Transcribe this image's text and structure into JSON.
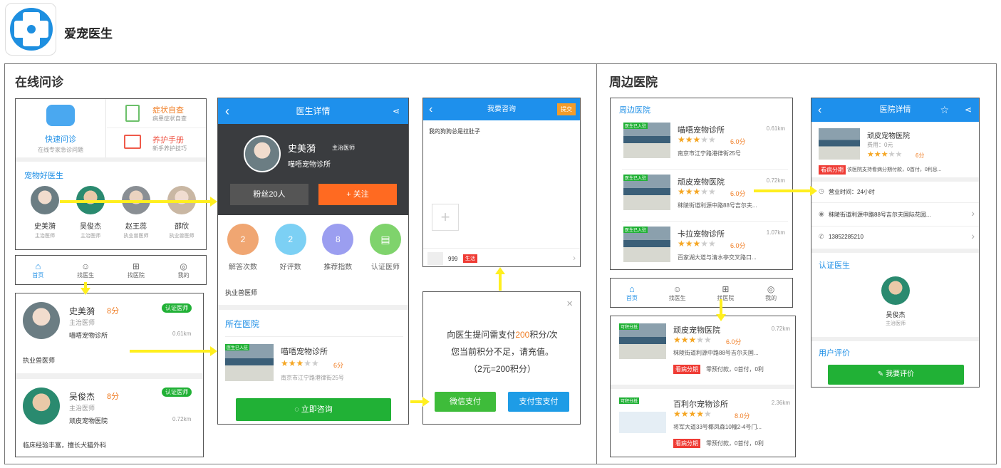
{
  "app": {
    "name": "爱宠医生"
  },
  "sections": {
    "consult": "在线问诊",
    "nearby": "周边医院"
  },
  "home": {
    "quick_title": "快速问诊",
    "quick_sub": "在线专家急诊问题",
    "symptom_title": "症状自查",
    "symptom_sub": "病患症状自查",
    "care_title": "养护手册",
    "care_sub": "新手养护技巧",
    "good_doctors": "宠物好医生",
    "doctors": [
      {
        "name": "史美漪",
        "title": "主治医师"
      },
      {
        "name": "吴俊杰",
        "title": "主治医师"
      },
      {
        "name": "赵王蕊",
        "title": "执业兽医师"
      },
      {
        "name": "邵欣",
        "title": "执业兽医师"
      }
    ]
  },
  "tabs": [
    "首页",
    "找医生",
    "找医院",
    "我的"
  ],
  "doctor_list": [
    {
      "name": "史美漪",
      "score": "8分",
      "badge": "认证医师",
      "title": "主治医师",
      "clinic": "喵唔宠物诊所",
      "distance": "0.61km",
      "desc": "执业兽医师"
    },
    {
      "name": "吴俊杰",
      "score": "8分",
      "badge": "认证医师",
      "title": "主治医师",
      "clinic": "顽皮宠物医院",
      "distance": "0.72km",
      "desc": "临床经验丰富，擅长犬猫外科"
    }
  ],
  "doctor_detail": {
    "header": "医生详情",
    "name": "史美漪",
    "title": "主治医师",
    "clinic": "喵唔宠物诊所",
    "fans": "粉丝20人",
    "follow": "+ 关注",
    "stats": [
      {
        "value": "2",
        "label": "解答次数",
        "color": "#f0a672"
      },
      {
        "value": "2",
        "label": "好评数",
        "color": "#7cd0f4"
      },
      {
        "value": "8",
        "label": "推荐指数",
        "color": "#9b9ef0"
      },
      {
        "value": "",
        "label": "认证医师",
        "color": "#7fd36c"
      }
    ],
    "desc": "执业兽医师",
    "hospital_title": "所在医院",
    "hospital_name": "喵唔宠物诊所",
    "hospital_score": "6分",
    "hospital_addr": "南京市江宁路港律街25号",
    "consult_btn": "立即咨询",
    "tag": "医生已入驻"
  },
  "ask": {
    "header": "我要咨询",
    "submit": "提交",
    "question": "我的狗狗总是拉肚子",
    "footer_text": "999",
    "footer_tag": "生活"
  },
  "pay_dialog": {
    "line1_pre": "向医生提问需支付",
    "line1_amount": "200",
    "line1_post": "积分/次",
    "line2": "您当前积分不足，请充值。",
    "line3": "（2元=200积分）",
    "wechat": "微信支付",
    "alipay": "支付宝支付"
  },
  "nearby_list": {
    "title": "周边医院",
    "items": [
      {
        "tag": "医生已入驻",
        "name": "喵唔宠物诊所",
        "score": "6.0分",
        "distance": "0.61km",
        "addr": "南京市江宁路港律街25号"
      },
      {
        "tag": "医生已入驻",
        "name": "顽皮宠物医院",
        "score": "6.0分",
        "distance": "0.72km",
        "addr": "秣陵街道利源中路88号吉尔夫..."
      },
      {
        "tag": "医生已入驻",
        "name": "卡拉宠物诊所",
        "score": "6.0分",
        "distance": "1.07km",
        "addr": "百家湖大道与清水亭交叉路口..."
      }
    ]
  },
  "nearby_list2": {
    "items": [
      {
        "tag": "可积分抵",
        "name": "顽皮宠物医院",
        "score": "6.0分",
        "distance": "0.72km",
        "addr": "秣陵街道利源中路88号吉尔夫国...",
        "pay_tag": "看病分期",
        "pay_text": "零预付款，0首付，0利"
      },
      {
        "tag": "可积分抵",
        "name": "百利尔宠物诊所",
        "score": "8.0分",
        "distance": "2.36km",
        "addr": "将军大道33号椰凤森10幢2-4号门...",
        "pay_tag": "看病分期",
        "pay_text": "零预付款，0首付，0利"
      }
    ]
  },
  "hospital_detail": {
    "header": "医院详情",
    "name": "顽皮宠物医院",
    "fee": "费用：0元",
    "score": "6分",
    "promo_tag": "看病分期",
    "promo_text": "该医院支持看病分期付款，0首付，0利息...",
    "hours": "营业时间：24小时",
    "addr": "秣陵街道利源中路88号吉尔夫国际花园...",
    "phone": "13852285210",
    "cert_title": "认证医生",
    "doctor_name": "吴俊杰",
    "doctor_title": "主治医师",
    "review_title": "用户评价",
    "review_btn": "我要评价"
  }
}
